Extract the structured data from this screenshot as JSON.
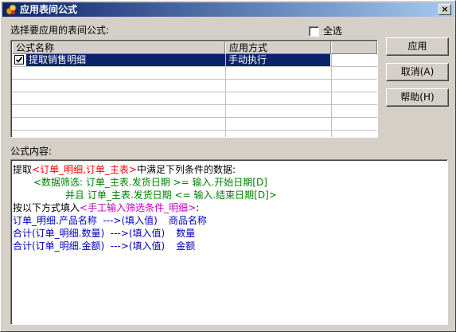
{
  "window": {
    "title": "应用表间公式",
    "close_glyph": "×"
  },
  "list_label": "选择要应用的表间公式:",
  "select_all_label": "全选",
  "select_all_checked": false,
  "table": {
    "columns": [
      "公式名称",
      "应用方式"
    ],
    "rows": [
      {
        "checked": true,
        "name": "提取销售明细",
        "mode": "手动执行",
        "selected": true
      }
    ]
  },
  "buttons": {
    "apply": "应用",
    "cancel": "取消(A)",
    "help": "帮助(H)"
  },
  "content_label": "公式内容:",
  "formula": {
    "line1": {
      "prefix": "提取",
      "tables": "<订单_明细,订单_主表>",
      "suffix": "中满足下列条件的数据:"
    },
    "line2": "<数据筛选: 订单_主表.发货日期 >= 输入.开始日期[D]",
    "line3": "并且 订单_主表.发货日期 <= 输入.结束日期[D]>",
    "line4": {
      "prefix": "按以下方式填入",
      "target": "<手工输入筛选条件_明细>",
      "suffix": ":"
    },
    "line5": {
      "left": "订单_明细.产品名称  --->(填入值)",
      "right": "商品名称"
    },
    "line6": {
      "left": "合计(订单_明细.数量)  --->(填入值)",
      "right": "数量"
    },
    "line7": {
      "left": "合计(订单_明细.金额)  --->(填入值)",
      "right": "金额"
    }
  },
  "colors": {
    "title_bar": "#0a246a",
    "selection": "#0a246a",
    "red_text": "#ff0000",
    "green_text": "#008000",
    "blue_text": "#0000c0"
  }
}
